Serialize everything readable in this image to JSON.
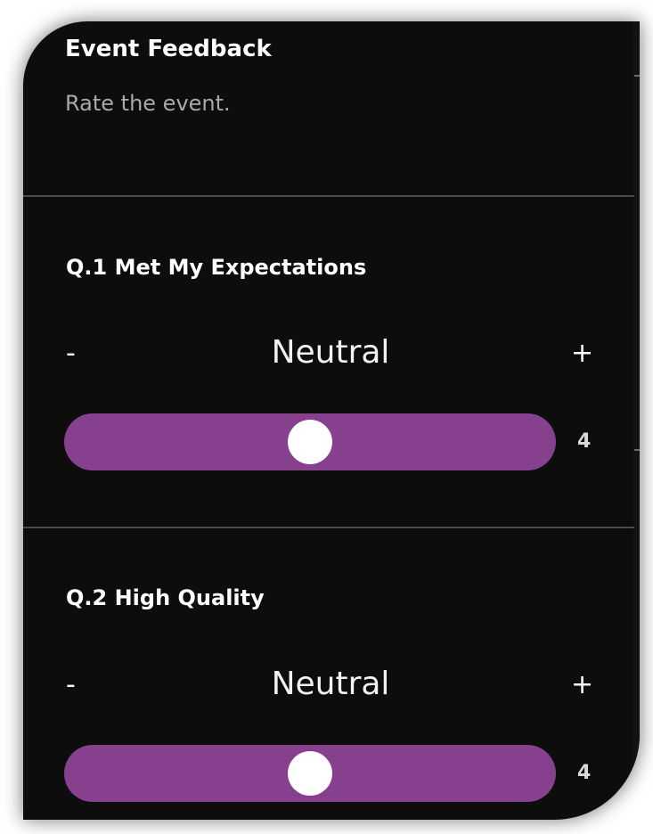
{
  "header": {
    "title": "Event Feedback",
    "subtitle": "Rate the event."
  },
  "questions": [
    {
      "title": "Q.1 Met My Expectations",
      "value_label": "Neutral",
      "minus_label": "-",
      "plus_label": "+",
      "rating": 4,
      "rating_label": "4",
      "rating_min": 1,
      "rating_max": 7
    },
    {
      "title": "Q.2 High Quality",
      "value_label": "Neutral",
      "minus_label": "-",
      "plus_label": "+",
      "rating": 4,
      "rating_label": "4",
      "rating_min": 1,
      "rating_max": 7
    }
  ],
  "colors": {
    "background": "#0d0d0d",
    "slider_track": "#86408d",
    "slider_thumb": "#ffffff",
    "title_text": "#ffffff",
    "subtitle_text": "#a9a9a9",
    "divider": "#4a4a4a"
  }
}
